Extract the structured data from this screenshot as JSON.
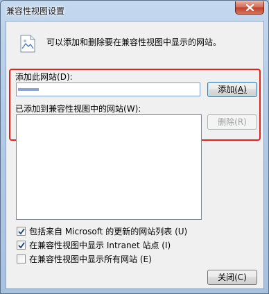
{
  "window": {
    "title": "兼容性视图设置"
  },
  "info": {
    "text": "可以添加和删除要在兼容性视图中显示的网站。"
  },
  "add_site": {
    "label": "添加此网站",
    "accel": "(D):",
    "input_value": "",
    "add_button": "添加",
    "add_accel": "(A)"
  },
  "added_sites": {
    "label": "已添加到兼容性视图中的网站",
    "accel": "(W):",
    "remove_button": "删除",
    "remove_accel": "(R)"
  },
  "options": [
    {
      "text": "包括来自 Microsoft 的更新的网站列表",
      "accel": "(U)",
      "checked": true
    },
    {
      "text": "在兼容性视图中显示 Intranet 站点",
      "accel": "(I)",
      "checked": true
    },
    {
      "text": "在兼容性视图中显示所有网站",
      "accel": "(E)",
      "checked": false
    }
  ],
  "footer": {
    "close_button": "关闭",
    "close_accel": "(C)"
  },
  "colors": {
    "highlight": "#e5221a",
    "title_bar": "#b3cbe6"
  }
}
